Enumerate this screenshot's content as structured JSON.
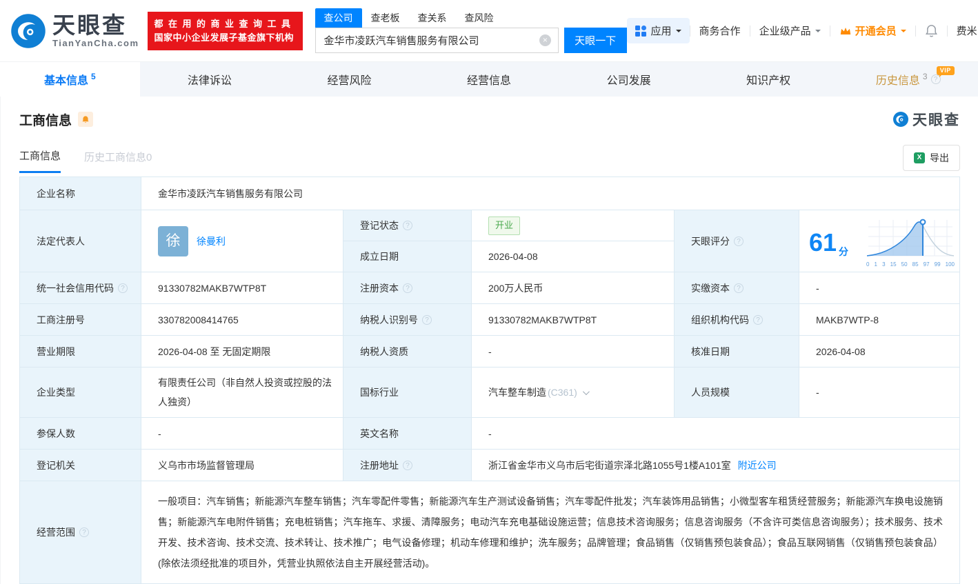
{
  "header": {
    "logo": {
      "title": "天眼查",
      "subtitle": "TianYanCha.com"
    },
    "banner": {
      "line1": "都在用的商业查询工具",
      "line2": "国家中小企业发展子基金旗下机构"
    },
    "search": {
      "tabs": [
        {
          "label": "查公司"
        },
        {
          "label": "查老板"
        },
        {
          "label": "查关系"
        },
        {
          "label": "查风险"
        }
      ],
      "value": "金华市凌跃汽车销售服务有限公司",
      "button": "天眼一下"
    },
    "menu": {
      "app": "应用",
      "cooperation": "商务合作",
      "enterprise": "企业级产品",
      "vip": "开通会员",
      "user": "费米"
    }
  },
  "nav_tabs": [
    {
      "label": "基本信息",
      "count": "5"
    },
    {
      "label": "法律诉讼"
    },
    {
      "label": "经营风险"
    },
    {
      "label": "经营信息"
    },
    {
      "label": "公司发展"
    },
    {
      "label": "知识产权"
    },
    {
      "label": "历史信息",
      "count": "3",
      "vip": "VIP"
    }
  ],
  "section": {
    "title": "工商信息",
    "watermark": "天眼查",
    "subtabs": [
      {
        "label": "工商信息"
      },
      {
        "label": "历史工商信息0"
      }
    ],
    "export_label": "导出"
  },
  "icons": {
    "help": "?",
    "clear": "×",
    "excel": "X"
  },
  "table": {
    "company_name_label": "企业名称",
    "company_name": "金华市凌跃汽车销售服务有限公司",
    "legal_rep_label": "法定代表人",
    "legal_rep_avatar": "徐",
    "legal_rep_name": "徐曼利",
    "reg_status_label": "登记状态",
    "reg_status": "开业",
    "establish_date_label": "成立日期",
    "establish_date": "2026-04-08",
    "score_label": "天眼评分",
    "score_value": "61",
    "score_unit": "分",
    "score_ticks": [
      "0",
      "1",
      "3",
      "15",
      "50",
      "85",
      "97",
      "99",
      "100"
    ],
    "credit_code_label": "统一社会信用代码",
    "credit_code": "91330782MAKB7WTP8T",
    "reg_capital_label": "注册资本",
    "reg_capital": "200万人民币",
    "paid_capital_label": "实缴资本",
    "paid_capital": "-",
    "reg_number_label": "工商注册号",
    "reg_number": "330782008414765",
    "taxpayer_id_label": "纳税人识别号",
    "taxpayer_id": "91330782MAKB7WTP8T",
    "org_code_label": "组织机构代码",
    "org_code": "MAKB7WTP-8",
    "business_term_label": "营业期限",
    "business_term": "2026-04-08 至 无固定期限",
    "taxpayer_quality_label": "纳税人资质",
    "taxpayer_quality": "-",
    "approval_date_label": "核准日期",
    "approval_date": "2026-04-08",
    "company_type_label": "企业类型",
    "company_type": "有限责任公司（非自然人投资或控股的法人独资）",
    "industry_label": "国标行业",
    "industry": "汽车整车制造",
    "industry_code": "(C361)",
    "staff_size_label": "人员规模",
    "staff_size": "-",
    "insured_label": "参保人数",
    "insured": "-",
    "english_name_label": "英文名称",
    "english_name": "-",
    "reg_authority_label": "登记机关",
    "reg_authority": "义乌市市场监督管理局",
    "address_label": "注册地址",
    "address": "浙江省金华市义乌市后宅街道宗泽北路1055号1楼A101室",
    "nearby_link": "附近公司",
    "business_scope_label": "经营范围",
    "business_scope": "一般项目：汽车销售；新能源汽车整车销售；汽车零配件零售；新能源汽车生产测试设备销售；汽车零配件批发；汽车装饰用品销售；小微型客车租赁经营服务；新能源汽车换电设施销售；新能源汽车电附件销售；充电桩销售；汽车拖车、求援、清障服务；电动汽车充电基础设施运营；信息技术咨询服务；信息咨询服务（不含许可类信息咨询服务）；技术服务、技术开发、技术咨询、技术交流、技术转让、技术推广；电气设备修理；机动车修理和维护；洗车服务；品牌管理；食品销售（仅销售预包装食品）；食品互联网销售（仅销售预包装食品）(除依法须经批准的项目外，凭营业执照依法自主开展经营活动)。"
  }
}
